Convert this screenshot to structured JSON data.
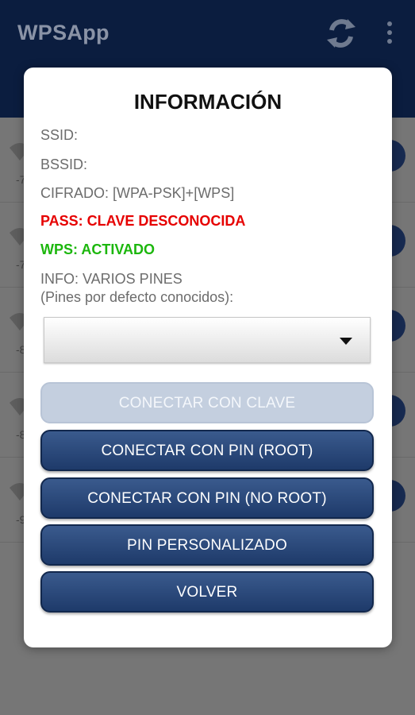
{
  "app": {
    "title": "WPSApp",
    "icons": {
      "refresh": "refresh-icon",
      "menu": "more-vert-icon",
      "network": "wifi-icon"
    },
    "colors": {
      "appbar": "#0b1d3f",
      "accent": "#1e3a6a",
      "pass": "#e60000",
      "wps": "#1cb70d"
    }
  },
  "list": {
    "rows": [
      {
        "level": "-7"
      },
      {
        "level": "-7"
      },
      {
        "level": "-8"
      },
      {
        "level": "-8"
      },
      {
        "level": "-9"
      }
    ]
  },
  "dialog": {
    "title": "INFORMACIÓN",
    "ssid": "SSID:",
    "bssid": "BSSID:",
    "cifrado": "CIFRADO: [WPA-PSK]+[WPS]",
    "pass": "PASS: CLAVE DESCONOCIDA",
    "wps": "WPS: ACTIVADO",
    "info_line1": "INFO: VARIOS PINES",
    "info_line2": "(Pines por defecto conocidos):",
    "spinner_value": "",
    "buttons": {
      "connect_key": "CONECTAR CON CLAVE",
      "connect_pin_root": "CONECTAR CON PIN (ROOT)",
      "connect_pin_noroot": "CONECTAR CON PIN (NO ROOT)",
      "custom_pin": "PIN PERSONALIZADO",
      "back": "VOLVER"
    }
  }
}
